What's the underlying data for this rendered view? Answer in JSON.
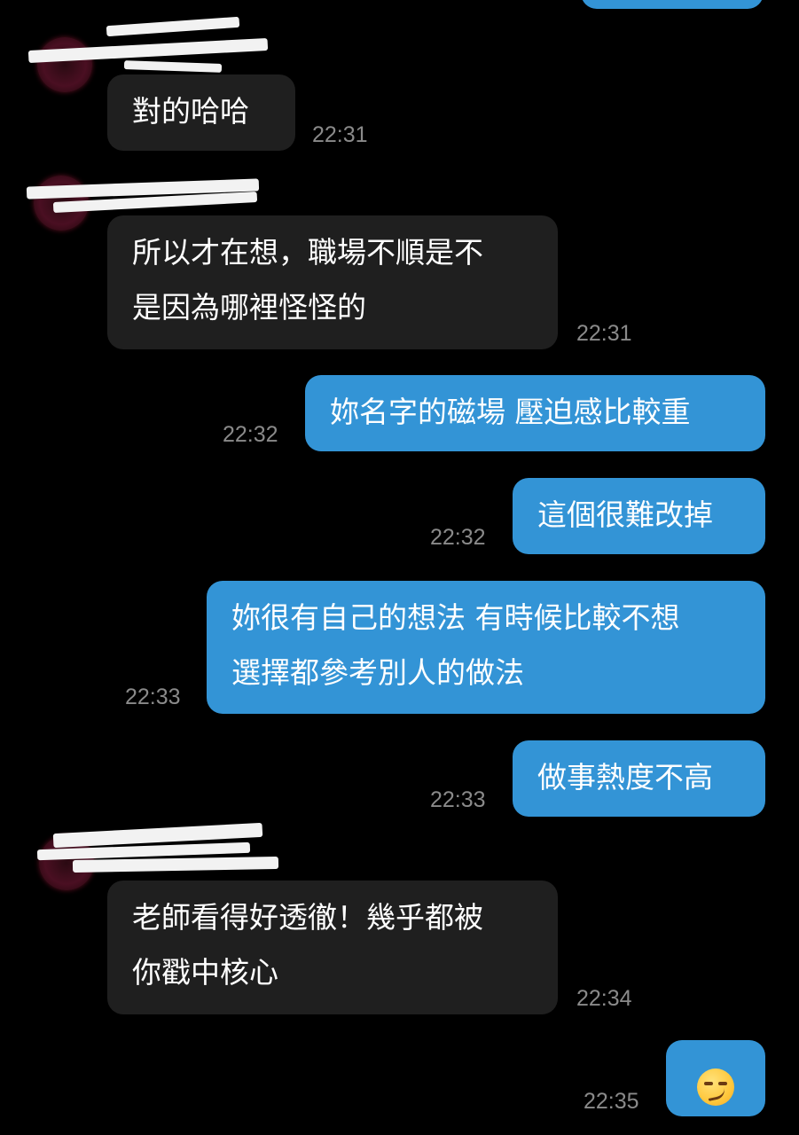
{
  "messages": [
    {
      "id": "m1",
      "side": "in",
      "lines": [
        "對的哈哈"
      ],
      "time": "22:31"
    },
    {
      "id": "m2",
      "side": "in",
      "lines": [
        "所以才在想，職場不順是不",
        "是因為哪裡怪怪的"
      ],
      "time": "22:31"
    },
    {
      "id": "m3",
      "side": "out",
      "lines": [
        "妳名字的磁場 壓迫感比較重"
      ],
      "time": "22:32"
    },
    {
      "id": "m4",
      "side": "out",
      "lines": [
        "這個很難改掉"
      ],
      "time": "22:32"
    },
    {
      "id": "m5",
      "side": "out",
      "lines": [
        "妳很有自己的想法 有時候比較不想",
        "選擇都參考別人的做法"
      ],
      "time": "22:33"
    },
    {
      "id": "m6",
      "side": "out",
      "lines": [
        "做事熱度不高"
      ],
      "time": "22:33"
    },
    {
      "id": "m7",
      "side": "in",
      "lines": [
        "老師看得好透徹！幾乎都被",
        "你戳中核心"
      ],
      "time": "22:34"
    },
    {
      "id": "m8",
      "side": "out",
      "emoji": "smirking-face",
      "time": "22:35"
    }
  ],
  "colors": {
    "background": "#000000",
    "incoming_bubble": "#1f1f1f",
    "outgoing_bubble": "#3394d6",
    "timestamp": "#8a8a8a"
  }
}
